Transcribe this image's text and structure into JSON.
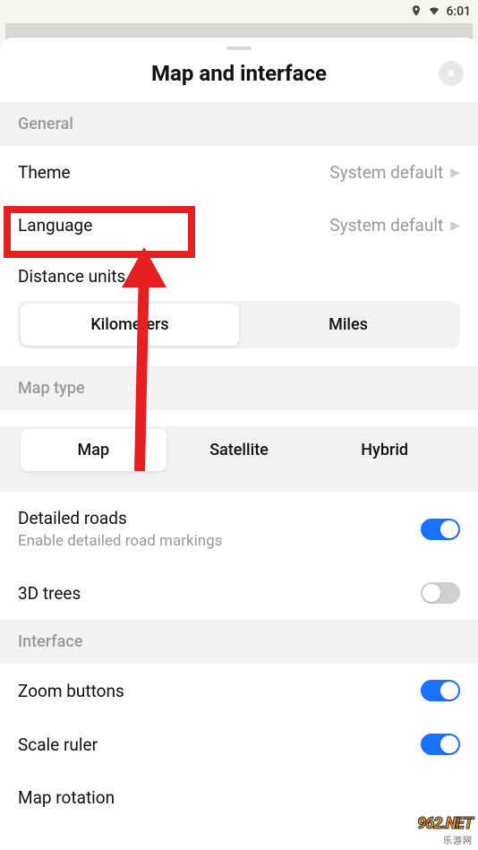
{
  "status": {
    "time": "6:01"
  },
  "sheet": {
    "title": "Map and interface"
  },
  "sections": {
    "general": {
      "header": "General",
      "theme": {
        "label": "Theme",
        "value": "System default"
      },
      "language": {
        "label": "Language",
        "value": "System default"
      },
      "distance": {
        "label": "Distance units",
        "options": [
          "Kilometers",
          "Miles"
        ],
        "selected": "Kilometers"
      }
    },
    "maptype": {
      "header": "Map type",
      "options": [
        "Map",
        "Satellite",
        "Hybrid"
      ],
      "selected": "Map",
      "detailed_roads": {
        "label": "Detailed roads",
        "sub": "Enable detailed road markings",
        "on": true
      },
      "trees": {
        "label": "3D trees",
        "on": false
      }
    },
    "interface": {
      "header": "Interface",
      "zoom": {
        "label": "Zoom buttons",
        "on": true
      },
      "scale": {
        "label": "Scale ruler",
        "on": true
      },
      "rotation": {
        "label": "Map rotation"
      }
    }
  },
  "watermark": {
    "top": "962.NET",
    "bottom": "乐游网"
  }
}
